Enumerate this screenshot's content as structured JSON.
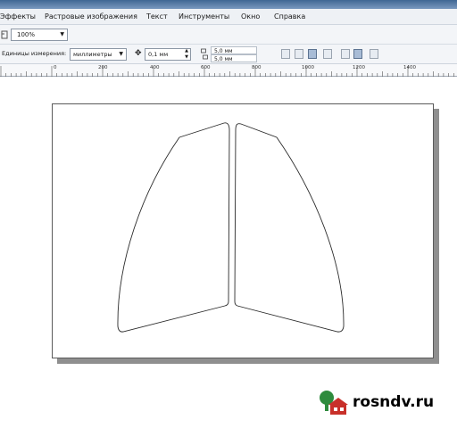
{
  "menu": {
    "items": [
      {
        "label": "Эффекты"
      },
      {
        "label": "Растровые изображения"
      },
      {
        "label": "Текст"
      },
      {
        "label": "Инструменты"
      },
      {
        "label": "Окно"
      },
      {
        "label": "Справка"
      }
    ]
  },
  "toolbar": {
    "zoom_value": "100%"
  },
  "property_bar": {
    "units_label": "Единицы измерения:",
    "units_value": "миллиметры",
    "nudge_value": "0,1 мм",
    "duplicate_x": "5,0 мм",
    "duplicate_y": "5,0 мм"
  },
  "ruler": {
    "labels": [
      "0",
      "200",
      "400",
      "600",
      "800",
      "1000",
      "1200",
      "1400"
    ]
  },
  "watermark": {
    "text": "rosndv.ru"
  },
  "colors": {
    "titlebar": "#4d6f98",
    "menubar": "#eef1f5",
    "page_border": "#5a5a5a",
    "shape_stroke": "#2a2a2a",
    "logo_green": "#2e8b3d",
    "logo_red": "#c8302a"
  }
}
